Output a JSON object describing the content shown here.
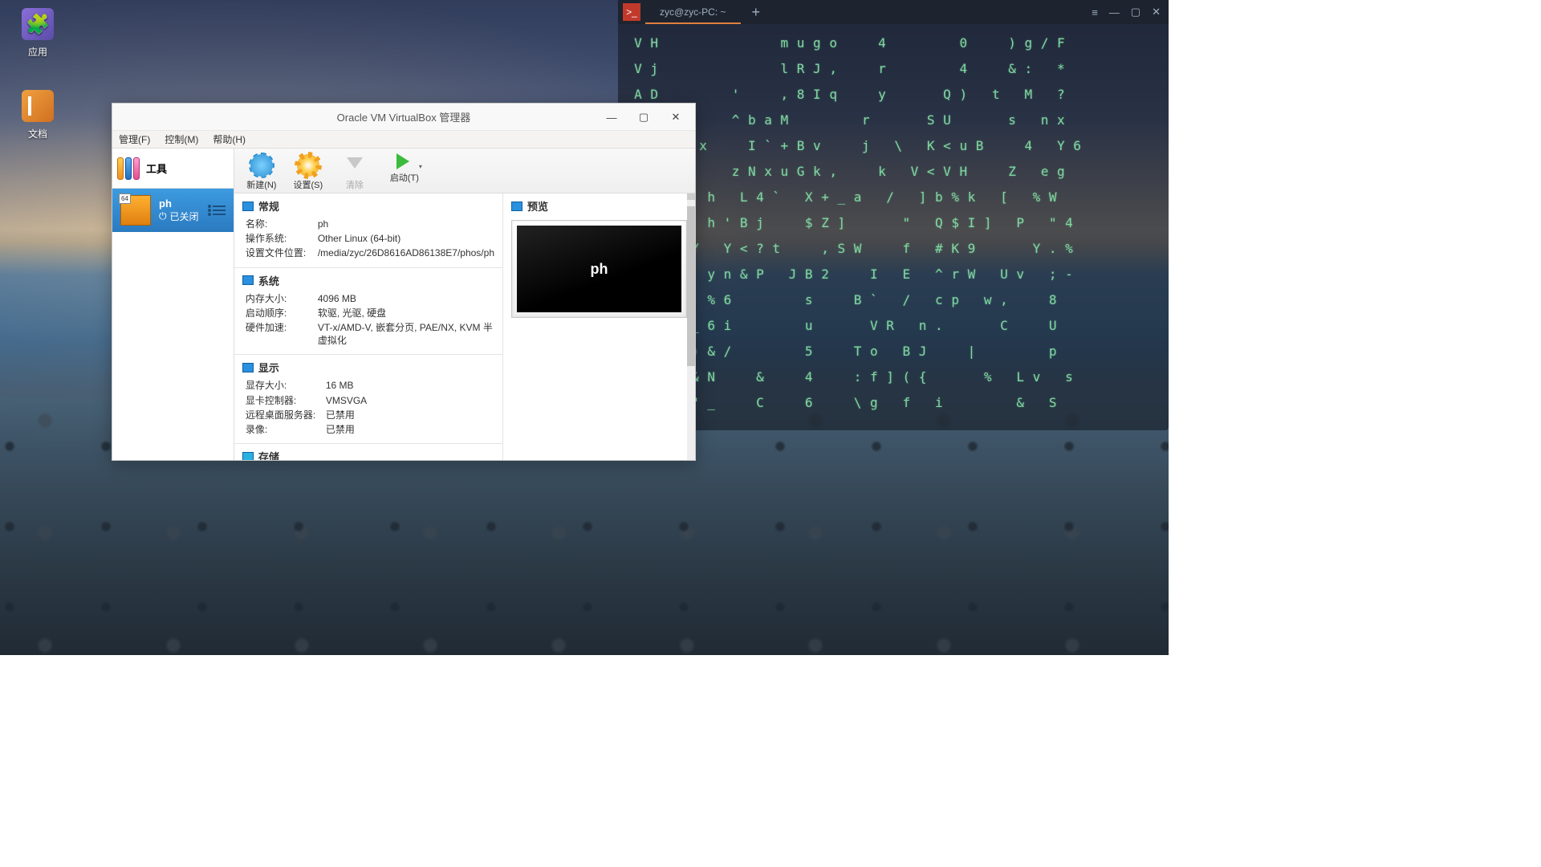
{
  "desktop": {
    "apps_label": "应用",
    "docs_label": "文档"
  },
  "terminal": {
    "tab": "zyc@zyc-PC: ~",
    "lines": [
      " V H               m u g o     4         0     ) g / F",
      " V j               l R J ,     r         4     & :   *",
      " A D         '     , 8 I q     y       Q )   t   M   ?",
      " W     *     ^ b a M         r       S U       s   n x",
      " x       x     I ` + B v     j   \\   K < u B     4   Y 6",
      " 8           z N x u G k ,     k   V < V H     Z   e g",
      "0 l       h   L 4 `   X + _ a   /   ] b % k   [   % W",
      "a n   D   h ' B j     $ Z ]       \"   Q $ I ]   P   \" 4",
      "' O     Y   Y < ? t     , S W     f   # K 9       Y . %",
      "/ A   q   y n & P   J B 2     I   E   ^ r W   U v   ; -",
      "A L ` }   % 6         s     B `   /   c p   w ,     8",
      "7 c w E _ 6 i         u       V R   n .       C     U",
      "X h j D ) & /         5     T o   B J     |         p",
      "? 5 ,   & N     &     4     : f ] ( {       %   L v   s",
      "      ] \" _     C     6     \\ g   f   i         &   S"
    ]
  },
  "vbox": {
    "title": "Oracle VM VirtualBox 管理器",
    "menu": {
      "manage": "管理(F)",
      "control": "控制(M)",
      "help": "帮助(H)"
    },
    "tools_label": "工具",
    "toolbar": {
      "new": "新建(N)",
      "settings": "设置(S)",
      "clear": "清除",
      "start": "启动(T)"
    },
    "vm": {
      "name": "ph",
      "state": "已关闭"
    },
    "sections": {
      "general": {
        "title": "常规",
        "name_k": "名称:",
        "name_v": "ph",
        "os_k": "操作系统:",
        "os_v": "Other Linux (64-bit)",
        "cfg_k": "设置文件位置:",
        "cfg_v": "/media/zyc/26D8616AD86138E7/phos/ph"
      },
      "system": {
        "title": "系统",
        "mem_k": "内存大小:",
        "mem_v": "4096 MB",
        "boot_k": "启动顺序:",
        "boot_v": "软驱, 光驱, 硬盘",
        "acc_k": "硬件加速:",
        "acc_v": "VT-x/AMD-V, 嵌套分页, PAE/NX, KVM 半虚拟化"
      },
      "display": {
        "title": "显示",
        "vram_k": "显存大小:",
        "vram_v": "16 MB",
        "ctrl_k": "显卡控制器:",
        "ctrl_v": "VMSVGA",
        "rdp_k": "远程桌面服务器:",
        "rdp_v": "已禁用",
        "rec_k": "录像:",
        "rec_v": "已禁用"
      },
      "storage_title": "存储"
    },
    "preview": {
      "title": "预览",
      "label": "ph"
    }
  }
}
